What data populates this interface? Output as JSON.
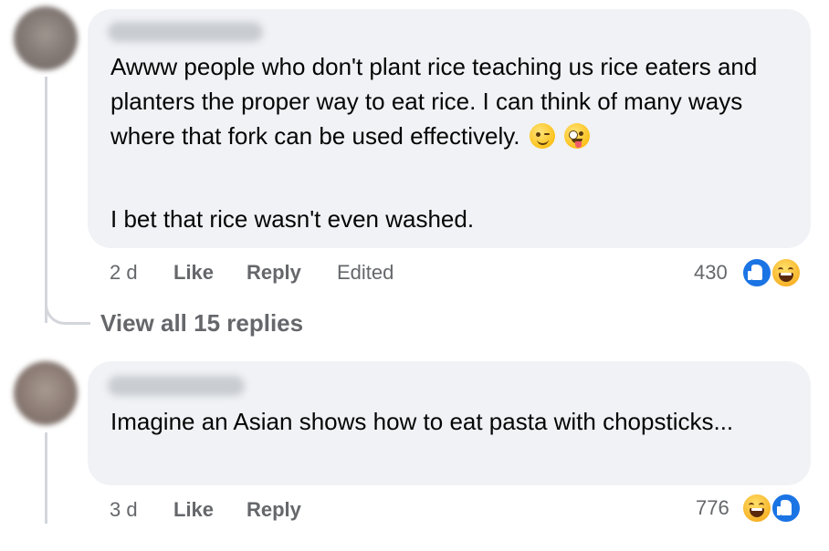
{
  "comments": [
    {
      "author_name": "",
      "paragraphs": [
        "Awww people who don't plant rice teaching us rice eaters and planters the proper way to eat rice. I can think of many ways where that fork can be used effectively.",
        "I bet that rice wasn't even washed."
      ],
      "inline_emojis": [
        "winking-face",
        "zany-face"
      ],
      "timestamp": "2 d",
      "like_label": "Like",
      "reply_label": "Reply",
      "edited_label": "Edited",
      "reaction_count": "430",
      "reactions": [
        "like",
        "haha"
      ]
    },
    {
      "author_name": "",
      "paragraphs": [
        "Imagine an Asian shows how to eat pasta with chopsticks..."
      ],
      "timestamp": "3 d",
      "like_label": "Like",
      "reply_label": "Reply",
      "reaction_count": "776",
      "reactions": [
        "haha",
        "like"
      ]
    }
  ],
  "view_replies_label": "View all 15 replies",
  "colors": {
    "bubble_bg": "#f0f2f5",
    "meta_text": "#65676b",
    "like_blue": "#1b74e4",
    "haha_yellow": "#f7b125"
  }
}
